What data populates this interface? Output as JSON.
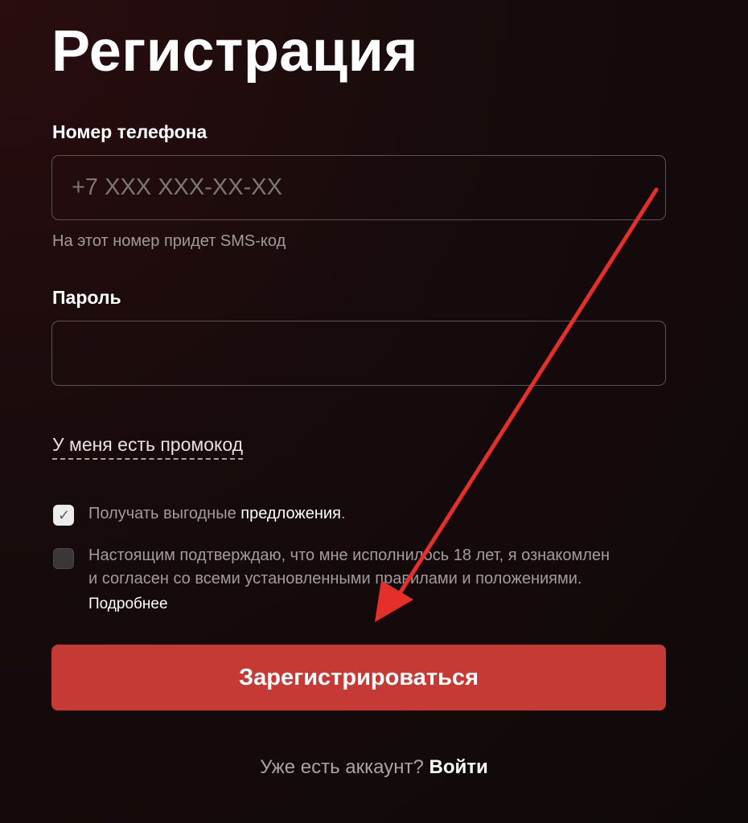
{
  "title": "Регистрация",
  "phone": {
    "label": "Номер телефона",
    "placeholder": "+7 XXX XXX-XX-XX",
    "hint": "На этот номер придет SMS-код"
  },
  "password": {
    "label": "Пароль",
    "value": ""
  },
  "promo_link": "У меня есть промокод",
  "offers_checkbox": {
    "checked": true,
    "text_prefix": "Получать выгодные ",
    "text_bright": "предложения",
    "text_suffix": "."
  },
  "age_checkbox": {
    "checked": false,
    "line1": "Настоящим подтверждаю, что мне исполнилось 18 лет, я ознакомлен",
    "line2": "и согласен со всеми установленными правилами и положениями.",
    "more_link": "Подробнее"
  },
  "submit_label": "Зарегистрироваться",
  "footer": {
    "question": "Уже есть аккаунт?",
    "login_link": "Войти"
  },
  "colors": {
    "accent": "#c63a36",
    "arrow": "#e5302a"
  }
}
